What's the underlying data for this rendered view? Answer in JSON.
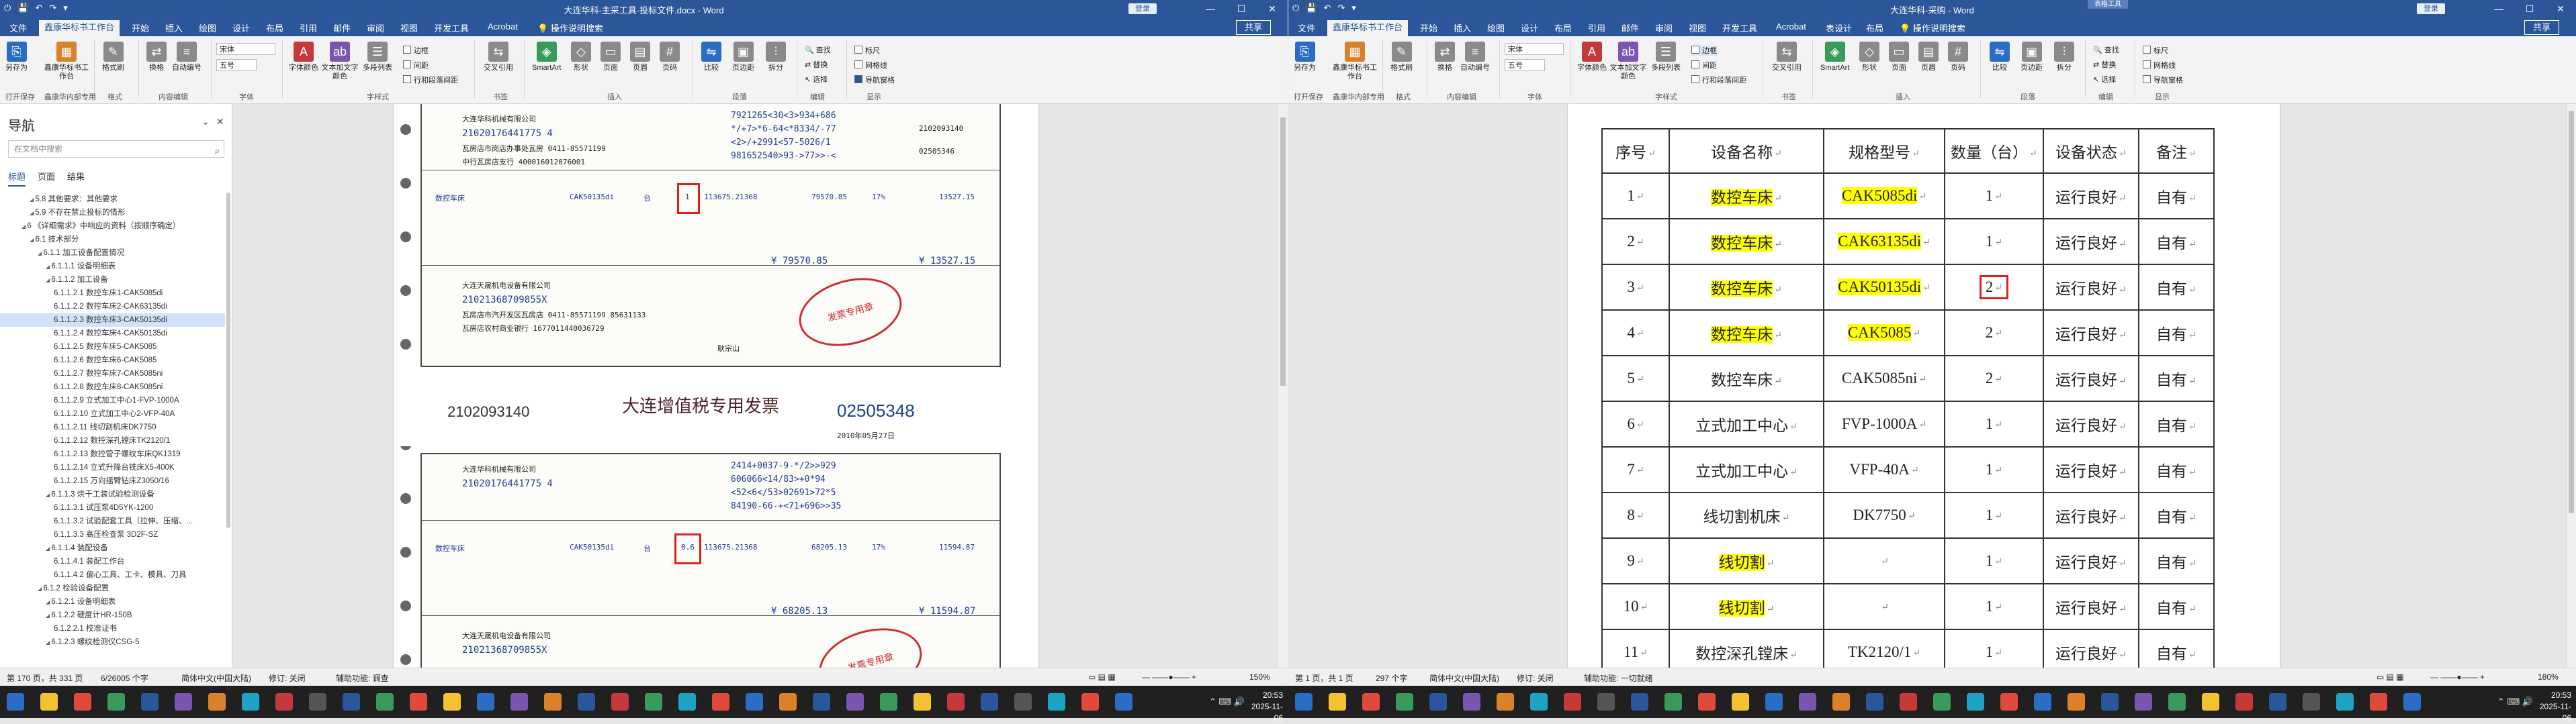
{
  "left_window": {
    "title": "大连华科-主采工具-投标文件.docx - Word",
    "login": "登录",
    "share": "共享",
    "tabs": [
      "文件",
      "鑫康华标书工作台",
      "开始",
      "插入",
      "绘图",
      "设计",
      "布局",
      "引用",
      "邮件",
      "审阅",
      "视图",
      "开发工具",
      "Acrobat",
      "操作说明搜索"
    ],
    "active_tab": "鑫康华标书工作台",
    "ribbon": {
      "save_as": "另存为",
      "workbench": "鑫康华标书工作台",
      "format_painter": "格式刷",
      "replace": "换格",
      "auto_number": "自动编号",
      "font_name": "宋体",
      "font_size": "五号",
      "font_color": "字体颜色",
      "text_format": "文本加文字颜色",
      "multi_select": "多段列表",
      "border": "边框",
      "spacing": "间距",
      "line_spacing": "行和段落间距",
      "cross_ref": "交叉引用",
      "smartart": "SmartArt",
      "shape": "形状",
      "page": "页面",
      "header": "页眉",
      "page_num": "页码",
      "compare": "比较",
      "merge": "页边距",
      "split": "拆分",
      "find": "查找",
      "replace2": "替换",
      "select": "选择",
      "ruler": "标尺",
      "gridlines": "网格线",
      "nav_pane": "导航窗格",
      "groups": [
        "打开保存",
        "鑫康华内部专用",
        "格式",
        "内容编辑",
        "字体",
        "字样式",
        "书签",
        "插入",
        "段落",
        "编辑",
        "小工具",
        "显示"
      ]
    },
    "nav": {
      "title": "导航",
      "search_placeholder": "在文档中搜索",
      "tabs": [
        "标题",
        "页面",
        "结果"
      ],
      "items": [
        "5.8 其他要求：其他要求",
        "5.9 不存在禁止投标的情形",
        "6 《详细需求》中响应的资料（按顺序确定）",
        "6.1 技术部分",
        "6.1.1 加工设备配置情况",
        "6.1.1.1 设备明细表",
        "6.1.1.2 加工设备",
        "6.1.1.2.1 数控车床1-CAK5085di",
        "6.1.1.2.2 数控车床2-CAK63135di",
        "6.1.1.2.3 数控车床3-CAK50135di",
        "6.1.1.2.4 数控车床4-CAK50135di",
        "6.1.1.2.5 数控车床5-CAK5085",
        "6.1.1.2.6 数控车床6-CAK5085",
        "6.1.1.2.7 数控车床7-CAK5085ni",
        "6.1.1.2.8 数控车床8-CAK5085ni",
        "6.1.1.2.9 立式加工中心1-FVP-1000A",
        "6.1.1.2.10 立式加工中心2-VFP-40A",
        "6.1.1.2.11 线切割机床DK7750",
        "6.1.1.2.12 数控深孔镗床TK2120/1",
        "6.1.1.2.13 数控管子螺纹车床QK1319",
        "6.1.1.2.14 立式升降台铣床X5-400K",
        "6.1.1.2.15 万向摇臂钻床Z3050/16",
        "6.1.1.3 烘干工装试验检测设备",
        "6.1.1.3.1 试压泵4D5YK-1200",
        "6.1.1.3.2 试验配套工具（拉伸、压缩、...",
        "6.1.1.3.3 高压检查泵 3D2F-SZ",
        "6.1.1.4 装配设备",
        "6.1.1.4.1 装配工作台",
        "6.1.1.4.2 偏心工具、工卡、模具、刀具",
        "6.1.2 检验设备配置",
        "6.1.2.1 设备明细表",
        "6.1.2.2 硬度计HR-150B",
        "6.1.2.2.1 校准证书",
        "6.1.2.3 螺纹检测仪CSG-5"
      ],
      "selected_index": 9
    },
    "invoice1": {
      "buyer": "大连华科机械有限公司",
      "tax_id": "21020176441775 4",
      "address": "瓦房店市岗店办事处瓦房 0411-85571199",
      "bank": "中行瓦房店支行 400016012076001",
      "cipher": [
        "7921265<30<3>934+686",
        "*/+7>*6-64<*8334/-77",
        "<2>/+2991<57-5026/1",
        "981652540>93->77>>-<"
      ],
      "code": "2102093140",
      "no": "02505346",
      "item": "数控车床",
      "model": "CAK50135di",
      "unit": "台",
      "qty": "1",
      "price": "113675.21368",
      "amount": "79570.85",
      "rate": "17%",
      "tax": "13527.15",
      "total_amount": "¥ 79570.85",
      "total_tax": "¥ 13527.15",
      "seller": "大连天晟机电设备有限公司",
      "seller_tax": "21021368709855X",
      "seller_addr": "瓦房店市汽开发区瓦房店 0411-85571199 85631133",
      "seller_bank": "瓦房店农村商业银行 1677011440036729",
      "stamp": "发票专用章",
      "drawer": "耿宗山"
    },
    "invoice2": {
      "code": "2102093140",
      "title": "大连增值税专用发票",
      "no": "02505348",
      "date": "2010年05月27日",
      "buyer": "大连华科机械有限公司",
      "tax_id": "21020176441775 4",
      "cipher": [
        "2414+0037-9-*/2>>929",
        "606066<14/83>+0*94",
        "<52<6</53>02691>72*5",
        "84190-66-+<71+696>>35"
      ],
      "item": "数控车床",
      "model": "CAK50135di",
      "unit": "台",
      "qty": "0.6",
      "price": "113675.21368",
      "amount": "68205.13",
      "rate": "17%",
      "tax": "11594.87",
      "total_amount": "¥ 68205.13",
      "total_tax": "¥ 11594.87",
      "seller": "大连天晟机电设备有限公司",
      "seller_tax": "21021368709855X"
    },
    "status": {
      "page": "第 170 页，共 331 页",
      "words": "6/26005 个字",
      "lang": "简体中文(中国大陆)",
      "track": "修订: 关闭",
      "access": "辅助功能: 调查",
      "zoom": "150%"
    }
  },
  "right_window": {
    "title": "大连华科-采购 - Word",
    "context_tab": "表格工具",
    "login": "登录",
    "share": "共享",
    "tabs": [
      "文件",
      "鑫康华标书工作台",
      "开始",
      "插入",
      "绘图",
      "设计",
      "布局",
      "引用",
      "邮件",
      "审阅",
      "视图",
      "开发工具",
      "Acrobat",
      "表设计",
      "布局",
      "操作说明搜索"
    ],
    "table": {
      "headers": [
        "序号",
        "设备名称",
        "规格型号",
        "数量（台）",
        "设备状态",
        "备注"
      ],
      "rows": [
        [
          "1",
          "数控车床",
          "CAK5085di",
          "1",
          "运行良好",
          "自有"
        ],
        [
          "2",
          "数控车床",
          "CAK63135di",
          "1",
          "运行良好",
          "自有"
        ],
        [
          "3",
          "数控车床",
          "CAK50135di",
          "2",
          "运行良好",
          "自有"
        ],
        [
          "4",
          "数控车床",
          "CAK5085",
          "2",
          "运行良好",
          "自有"
        ],
        [
          "5",
          "数控车床",
          "CAK5085ni",
          "2",
          "运行良好",
          "自有"
        ],
        [
          "6",
          "立式加工中心",
          "FVP-1000A",
          "1",
          "运行良好",
          "自有"
        ],
        [
          "7",
          "立式加工中心",
          "VFP-40A",
          "1",
          "运行良好",
          "自有"
        ],
        [
          "8",
          "线切割机床",
          "DK7750",
          "1",
          "运行良好",
          "自有"
        ],
        [
          "9",
          "线切割",
          "",
          "1",
          "运行良好",
          "自有"
        ],
        [
          "10",
          "线切割",
          "",
          "1",
          "运行良好",
          "自有"
        ],
        [
          "11",
          "数控深孔镗床",
          "TK2120/1",
          "1",
          "运行良好",
          "自有"
        ]
      ]
    },
    "status": {
      "page": "第 1 页，共 1 页",
      "words": "297 个字",
      "lang": "简体中文(中国大陆)",
      "track": "修订: 关闭",
      "access": "辅助功能: 一切就绪",
      "zoom": "180%"
    }
  },
  "taskbar": {
    "time1": "20:53",
    "date1": "2025-11-06",
    "time2": "20:53",
    "date2": "2025-11-06"
  }
}
